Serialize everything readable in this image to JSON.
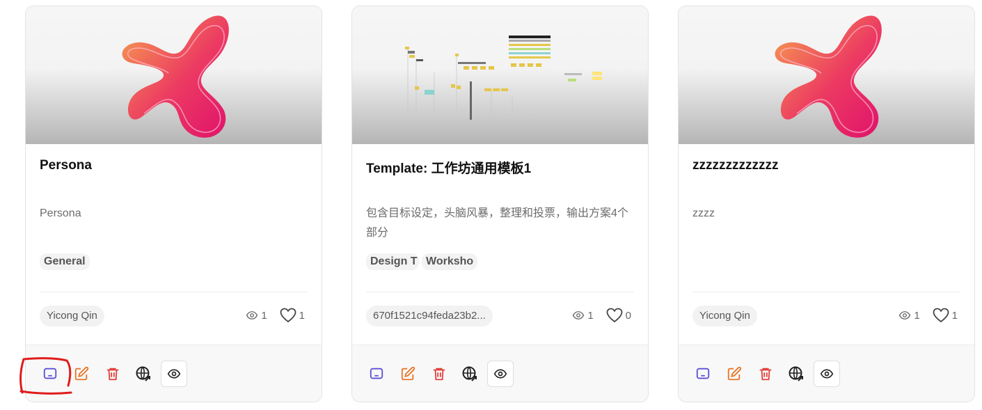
{
  "cards": [
    {
      "title": "Persona",
      "description": "Persona",
      "tags": [
        "General"
      ],
      "owner": "Yicong Qin",
      "views": "1",
      "likes": "1",
      "thumbnail": "logo"
    },
    {
      "title": "Template: 工作坊通用模板1",
      "description": "包含目标设定，头脑风暴，整理和投票，输出方案4个部分",
      "tags": [
        "Design T",
        "Worksho"
      ],
      "owner": "670f1521c94feda23b2...",
      "views": "1",
      "likes": "0",
      "thumbnail": "board-preview"
    },
    {
      "title": "zzzzzzzzzzzzz",
      "description": "zzzz",
      "tags": [],
      "owner": "Yicong Qin",
      "views": "1",
      "likes": "1",
      "thumbnail": "logo"
    }
  ],
  "actions": [
    {
      "name": "present-icon",
      "color": "#5b4fd6"
    },
    {
      "name": "edit-icon",
      "color": "#e8762b"
    },
    {
      "name": "delete-icon",
      "color": "#e0413c"
    },
    {
      "name": "share-web-icon",
      "color": "#222222"
    },
    {
      "name": "preview-eye-icon",
      "color": "#222222"
    }
  ],
  "colors": {
    "logo_gradient_start": "#f59a4f",
    "logo_gradient_end": "#e8156a",
    "annotation": "#e01b1b"
  }
}
